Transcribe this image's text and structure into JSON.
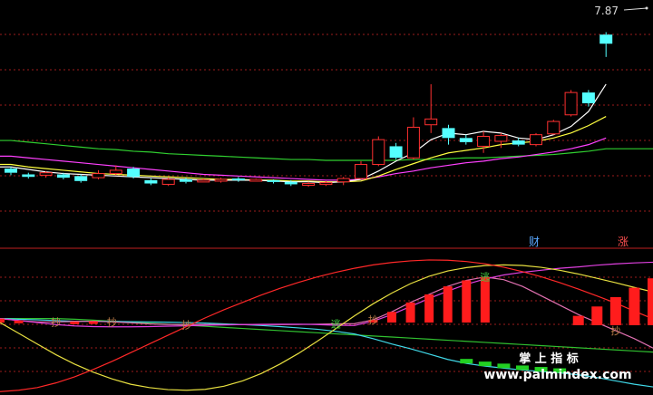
{
  "price_label": "7.87",
  "markers": [
    {
      "text": "财",
      "color": "#5aa8ff"
    },
    {
      "text": "涨",
      "color": "#ff5050"
    }
  ],
  "watermark": {
    "line1": "掌 上 指 标",
    "line2": "www.palmindex.com"
  },
  "osc_signals": [
    {
      "text": "抄",
      "color": "#c0804a"
    },
    {
      "text": "抄",
      "color": "#c0804a"
    },
    {
      "text": "抄",
      "color": "#c0804a"
    },
    {
      "text": "逃",
      "color": "#40d040"
    },
    {
      "text": "抄",
      "color": "#c0804a"
    },
    {
      "text": "逃",
      "color": "#40d040"
    },
    {
      "text": "抄",
      "color": "#c0804a"
    }
  ],
  "colors": {
    "up": "#ff3030",
    "down": "#54ffff",
    "ma5": "#ffffff",
    "ma10": "#ffff40",
    "ma20": "#ff40ff",
    "ma60": "#30d030",
    "grid": "#9b1b1b"
  },
  "chart_data": {
    "type": "candlestick",
    "price_axis": {
      "ymin": 5.0,
      "ymax": 7.87
    },
    "candles": [
      {
        "o": 5.93,
        "c": 5.88,
        "h": 5.95,
        "l": 5.85
      },
      {
        "o": 5.86,
        "c": 5.83,
        "h": 5.88,
        "l": 5.81
      },
      {
        "o": 5.85,
        "c": 5.88,
        "h": 5.9,
        "l": 5.82
      },
      {
        "o": 5.86,
        "c": 5.82,
        "h": 5.88,
        "l": 5.8
      },
      {
        "o": 5.84,
        "c": 5.78,
        "h": 5.86,
        "l": 5.76
      },
      {
        "o": 5.82,
        "c": 5.87,
        "h": 5.91,
        "l": 5.8
      },
      {
        "o": 5.87,
        "c": 5.91,
        "h": 5.97,
        "l": 5.85
      },
      {
        "o": 5.93,
        "c": 5.83,
        "h": 5.95,
        "l": 5.81
      },
      {
        "o": 5.79,
        "c": 5.75,
        "h": 5.81,
        "l": 5.73
      },
      {
        "o": 5.74,
        "c": 5.8,
        "h": 5.82,
        "l": 5.72
      },
      {
        "o": 5.8,
        "c": 5.77,
        "h": 5.82,
        "l": 5.75
      },
      {
        "o": 5.78,
        "c": 5.79,
        "h": 5.81,
        "l": 5.77
      },
      {
        "o": 5.78,
        "c": 5.8,
        "h": 5.82,
        "l": 5.76
      },
      {
        "o": 5.81,
        "c": 5.79,
        "h": 5.83,
        "l": 5.77
      },
      {
        "o": 5.79,
        "c": 5.8,
        "h": 5.81,
        "l": 5.78
      },
      {
        "o": 5.79,
        "c": 5.77,
        "h": 5.8,
        "l": 5.75
      },
      {
        "o": 5.77,
        "c": 5.74,
        "h": 5.79,
        "l": 5.72
      },
      {
        "o": 5.74,
        "c": 5.75,
        "h": 5.77,
        "l": 5.71
      },
      {
        "o": 5.74,
        "c": 5.76,
        "h": 5.78,
        "l": 5.72
      },
      {
        "o": 5.77,
        "c": 5.81,
        "h": 5.83,
        "l": 5.73
      },
      {
        "o": 5.81,
        "c": 5.98,
        "h": 6.02,
        "l": 5.8
      },
      {
        "o": 5.98,
        "c": 6.28,
        "h": 6.32,
        "l": 5.96
      },
      {
        "o": 6.2,
        "c": 6.06,
        "h": 6.24,
        "l": 6.04
      },
      {
        "o": 6.06,
        "c": 6.43,
        "h": 6.55,
        "l": 6.04
      },
      {
        "o": 6.46,
        "c": 6.53,
        "h": 6.95,
        "l": 6.36
      },
      {
        "o": 6.42,
        "c": 6.3,
        "h": 6.46,
        "l": 6.22
      },
      {
        "o": 6.3,
        "c": 6.25,
        "h": 6.34,
        "l": 6.22
      },
      {
        "o": 6.2,
        "c": 6.32,
        "h": 6.38,
        "l": 6.12
      },
      {
        "o": 6.26,
        "c": 6.33,
        "h": 6.36,
        "l": 6.18
      },
      {
        "o": 6.27,
        "c": 6.22,
        "h": 6.3,
        "l": 6.2
      },
      {
        "o": 6.22,
        "c": 6.34,
        "h": 6.36,
        "l": 6.2
      },
      {
        "o": 6.35,
        "c": 6.5,
        "h": 6.52,
        "l": 6.34
      },
      {
        "o": 6.58,
        "c": 6.85,
        "h": 6.88,
        "l": 6.56
      },
      {
        "o": 6.85,
        "c": 6.72,
        "h": 6.88,
        "l": 6.68
      },
      {
        "o": 7.55,
        "c": 7.44,
        "h": 7.58,
        "l": 7.28
      }
    ],
    "ma5": [
      5.95,
      5.92,
      5.89,
      5.87,
      5.86,
      5.85,
      5.84,
      5.83,
      5.82,
      5.81,
      5.8,
      5.79,
      5.79,
      5.79,
      5.79,
      5.78,
      5.77,
      5.77,
      5.76,
      5.77,
      5.8,
      5.9,
      6.02,
      6.12,
      6.28,
      6.36,
      6.34,
      6.38,
      6.36,
      6.3,
      6.28,
      6.34,
      6.44,
      6.62,
      6.95
    ],
    "ma10": [
      5.98,
      5.95,
      5.93,
      5.91,
      5.89,
      5.87,
      5.86,
      5.85,
      5.84,
      5.83,
      5.82,
      5.81,
      5.8,
      5.8,
      5.79,
      5.79,
      5.78,
      5.78,
      5.77,
      5.77,
      5.78,
      5.84,
      5.92,
      5.99,
      6.06,
      6.12,
      6.15,
      6.18,
      6.22,
      6.24,
      6.26,
      6.3,
      6.36,
      6.45,
      6.56
    ],
    "ma20": [
      6.08,
      6.06,
      6.04,
      6.02,
      6.0,
      5.98,
      5.96,
      5.94,
      5.92,
      5.9,
      5.88,
      5.86,
      5.85,
      5.84,
      5.83,
      5.82,
      5.81,
      5.8,
      5.79,
      5.79,
      5.8,
      5.83,
      5.87,
      5.9,
      5.94,
      5.97,
      6.0,
      6.02,
      6.05,
      6.07,
      6.1,
      6.13,
      6.17,
      6.22,
      6.3
    ],
    "ma60": [
      6.27,
      6.25,
      6.23,
      6.21,
      6.19,
      6.17,
      6.16,
      6.14,
      6.13,
      6.11,
      6.1,
      6.09,
      6.08,
      6.07,
      6.06,
      6.05,
      6.04,
      6.04,
      6.03,
      6.03,
      6.03,
      6.03,
      6.03,
      6.04,
      6.04,
      6.05,
      6.06,
      6.06,
      6.07,
      6.08,
      6.09,
      6.1,
      6.12,
      6.14,
      6.17
    ],
    "oscillator": {
      "ymin": 0,
      "ymax": 100,
      "red": [
        0.5,
        1.5,
        3.5,
        7,
        11.5,
        17,
        23,
        29.5,
        36,
        42.5,
        49,
        55.5,
        61.5,
        67,
        72.5,
        77.5,
        82,
        86,
        89.5,
        92.5,
        95,
        96.8,
        98,
        98.7,
        98.5,
        97.5,
        95.8,
        93.3,
        90,
        86.2,
        81.8,
        77,
        71.8,
        66.5,
        60.5,
        54.8
      ],
      "yellow": [
        52,
        44,
        36,
        28,
        21,
        15,
        10,
        6,
        3.5,
        2,
        1.5,
        2.2,
        4.5,
        8.5,
        14,
        21,
        29,
        38,
        47.5,
        57,
        66,
        74,
        81,
        86.5,
        90.5,
        93,
        94.5,
        95,
        94.6,
        93.2,
        91,
        88.2,
        85,
        81.7,
        78.2,
        74.8
      ],
      "magenta": [
        55,
        53.5,
        52,
        50.5,
        49.5,
        49,
        48.8,
        48.8,
        49,
        49.3,
        49.6,
        50,
        50.2,
        50.5,
        50.7,
        50.8,
        50.8,
        50.5,
        50,
        49.8,
        53,
        58,
        64,
        70,
        75.5,
        80.5,
        84.5,
        87.5,
        89.5,
        91,
        92.5,
        93.5,
        94.8,
        95.8,
        96.5,
        97
      ],
      "cyan": [
        55,
        54.5,
        54,
        53.5,
        53,
        53,
        52.8,
        52.6,
        52.5,
        52.3,
        52,
        51.6,
        51,
        50.5,
        49.8,
        49,
        48,
        47,
        45.5,
        43.5,
        40,
        36,
        32.5,
        28.5,
        24.5,
        21.5,
        19.5,
        18,
        16.6,
        15.5,
        14.5,
        13,
        11,
        8.5,
        6,
        4
      ],
      "pink": [
        55,
        53.5,
        52.5,
        52.5,
        52.8,
        53,
        52.5,
        51.8,
        51,
        50.6,
        50.5,
        50.5,
        50.5,
        50.4,
        50.5,
        50.5,
        50.6,
        50.8,
        51,
        51.2,
        54,
        60,
        67,
        73,
        79,
        83.5,
        86,
        84,
        79,
        72,
        65,
        58,
        52,
        46,
        40,
        33
      ],
      "green": [
        55,
        55,
        55,
        55,
        54.5,
        53.8,
        53,
        52.3,
        51.5,
        50.8,
        50,
        49.2,
        48.4,
        47.6,
        46.8,
        46,
        45.2,
        44.4,
        43.6,
        42.8,
        42,
        41.2,
        40.4,
        39.6,
        38.8,
        38,
        37.2,
        36.4,
        35.6,
        34.8,
        34,
        33.2,
        32.4,
        31.6,
        30.8,
        30
      ]
    }
  }
}
